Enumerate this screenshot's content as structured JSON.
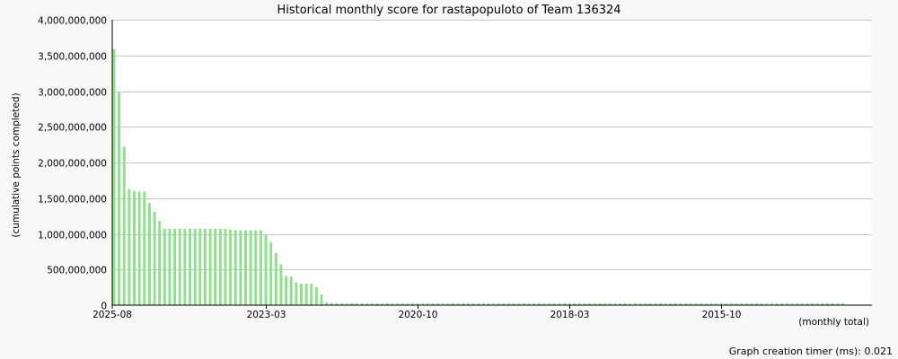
{
  "chart_data": {
    "type": "bar",
    "title": "Historical monthly score for rastapopuloto of Team 136324",
    "ylabel": "(cumulative points completed)",
    "xlabel": "(monthly total)",
    "ylim": [
      0,
      4000000000
    ],
    "yticks": [
      0,
      500000000,
      1000000000,
      1500000000,
      2000000000,
      2500000000,
      3000000000,
      3500000000,
      4000000000
    ],
    "ytick_labels": [
      "0",
      "500,000,000",
      "1,000,000,000",
      "1,500,000,000",
      "2,000,000,000",
      "2,500,000,000",
      "3,000,000,000",
      "3,500,000,000",
      "4,000,000,000"
    ],
    "xtick_labels": [
      "2025-08",
      "2023-03",
      "2020-10",
      "2018-03",
      "2015-10"
    ],
    "xtick_indices": [
      0,
      30,
      60,
      90,
      120
    ],
    "grid": true,
    "bar_color": "#90e090",
    "series": [
      {
        "values": [
          3590000000,
          2980000000,
          2220000000,
          1630000000,
          1600000000,
          1590000000,
          1590000000,
          1430000000,
          1310000000,
          1180000000,
          1070000000,
          1070000000,
          1070000000,
          1070000000,
          1070000000,
          1070000000,
          1070000000,
          1070000000,
          1070000000,
          1070000000,
          1070000000,
          1070000000,
          1070000000,
          1060000000,
          1050000000,
          1050000000,
          1050000000,
          1050000000,
          1050000000,
          1050000000,
          980000000,
          880000000,
          730000000,
          570000000,
          410000000,
          400000000,
          320000000,
          300000000,
          300000000,
          300000000,
          250000000,
          150000000,
          40000000,
          30000000,
          25000000,
          25000000,
          25000000,
          25000000,
          25000000,
          25000000,
          25000000,
          25000000,
          25000000,
          25000000,
          25000000,
          25000000,
          25000000,
          25000000,
          25000000,
          25000000,
          25000000,
          25000000,
          25000000,
          25000000,
          25000000,
          25000000,
          25000000,
          25000000,
          25000000,
          25000000,
          25000000,
          25000000,
          25000000,
          25000000,
          25000000,
          25000000,
          25000000,
          25000000,
          25000000,
          25000000,
          25000000,
          25000000,
          25000000,
          25000000,
          25000000,
          25000000,
          25000000,
          25000000,
          25000000,
          25000000,
          25000000,
          25000000,
          25000000,
          25000000,
          25000000,
          25000000,
          25000000,
          25000000,
          25000000,
          25000000,
          25000000,
          25000000,
          25000000,
          25000000,
          25000000,
          25000000,
          25000000,
          25000000,
          25000000,
          25000000,
          25000000,
          25000000,
          25000000,
          25000000,
          25000000,
          25000000,
          25000000,
          25000000,
          25000000,
          25000000,
          25000000,
          25000000,
          25000000,
          25000000,
          25000000,
          25000000,
          25000000,
          25000000,
          25000000,
          25000000,
          25000000,
          25000000,
          25000000,
          25000000,
          25000000,
          25000000,
          25000000,
          25000000,
          25000000,
          25000000,
          25000000,
          25000000,
          25000000,
          25000000,
          25000000
        ]
      }
    ]
  },
  "footer_text": "Graph creation timer (ms): 0.021"
}
